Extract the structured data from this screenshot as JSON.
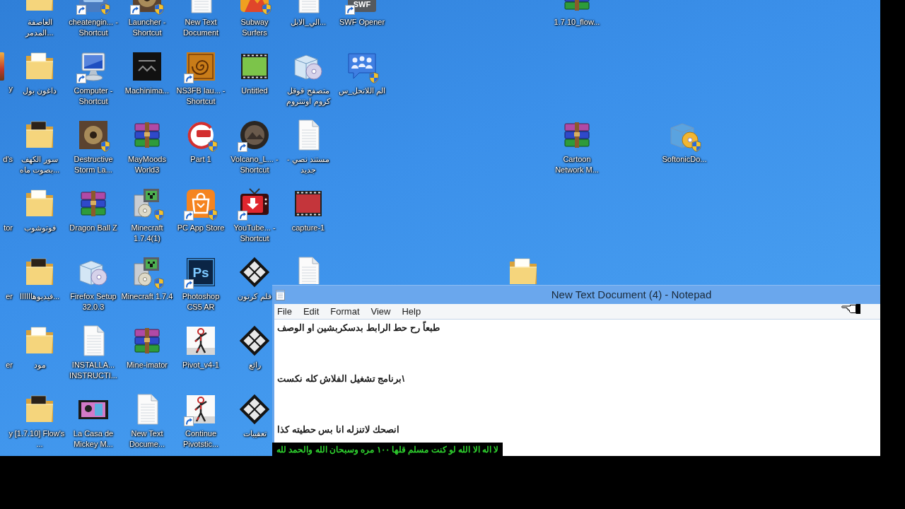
{
  "desktop": {
    "columns": [
      {
        "icons": [
          {
            "kind": "empty"
          },
          {
            "kind": "sliver",
            "label": "y"
          },
          {
            "kind": "cut",
            "label": "d's"
          },
          {
            "kind": "cut",
            "label": "tor"
          },
          {
            "kind": "cut",
            "label": "er"
          },
          {
            "kind": "cut",
            "label": "er"
          },
          {
            "kind": "cut",
            "label": "y"
          }
        ]
      },
      {
        "icons": [
          {
            "kind": "folder",
            "label": "العاصفة المدمر...",
            "shortcut": false,
            "shield": false
          },
          {
            "kind": "folder",
            "label": "داغون بول",
            "shortcut": false,
            "shield": false
          },
          {
            "kind": "folder-dark",
            "label": "سور الكهف بصوت ماه...",
            "shortcut": false,
            "shield": false
          },
          {
            "kind": "folder",
            "label": "فوتوشوب",
            "shortcut": false,
            "shield": false
          },
          {
            "kind": "folder-dark",
            "label": "فيديوهاااااا...",
            "shortcut": false,
            "shield": false
          },
          {
            "kind": "folder",
            "label": "مود",
            "shortcut": false,
            "shield": false
          },
          {
            "kind": "folder-dark",
            "label": "[1.7.10] Flow's ...",
            "shortcut": false,
            "shield": false
          }
        ]
      },
      {
        "icons": [
          {
            "kind": "blue-app",
            "label": "cheatengin... - Shortcut",
            "shortcut": true,
            "shield": true
          },
          {
            "kind": "monitor",
            "label": "Computer - Shortcut",
            "shortcut": true,
            "shield": false
          },
          {
            "kind": "bronze-app",
            "label": "Destructive Storm La...",
            "shortcut": false,
            "shield": true
          },
          {
            "kind": "archive",
            "label": "Dragon Ball Z",
            "shortcut": false,
            "shield": false
          },
          {
            "kind": "box-disc",
            "label": "Firefox Setup 32.0.3",
            "shortcut": false,
            "shield": false
          },
          {
            "kind": "document",
            "label": "INSTALLA... INSTRUCTI...",
            "shortcut": false,
            "shield": false
          },
          {
            "kind": "video-thumb",
            "label": "La Casa de Mickey M...",
            "shortcut": false,
            "shield": false
          }
        ]
      },
      {
        "icons": [
          {
            "kind": "bronze-app",
            "label": "Launcher - Shortcut",
            "shortcut": true,
            "shield": true
          },
          {
            "kind": "dark-app",
            "label": "Machinima...",
            "shortcut": false,
            "shield": false
          },
          {
            "kind": "archive",
            "label": "MayMoods World3",
            "shortcut": false,
            "shield": false
          },
          {
            "kind": "minecraft-installer",
            "label": "Minecraft 1.7.4(1)",
            "shortcut": false,
            "shield": true
          },
          {
            "kind": "minecraft-installer",
            "label": "Minecraft 1.7.4",
            "shortcut": false,
            "shield": true
          },
          {
            "kind": "archive",
            "label": "Mine-imator",
            "shortcut": false,
            "shield": false
          },
          {
            "kind": "document",
            "label": "New Text Docume...",
            "shortcut": false,
            "shield": false
          }
        ]
      },
      {
        "icons": [
          {
            "kind": "document",
            "label": "New Text Document",
            "shortcut": false,
            "shield": false
          },
          {
            "kind": "spiral-app",
            "label": "NS3FB lau... - Shortcut",
            "shortcut": true,
            "shield": false
          },
          {
            "kind": "ring-logo",
            "label": "Part 1",
            "shortcut": false,
            "shield": true
          },
          {
            "kind": "bag",
            "label": "PC App Store",
            "shortcut": true,
            "shield": true
          },
          {
            "kind": "ps-app",
            "logo_text": "Ps",
            "label": "Photoshop CS5 AR",
            "shortcut": true,
            "shield": false
          },
          {
            "kind": "stick-figure",
            "label": "Pivot_v4-1",
            "shortcut": false,
            "shield": false
          },
          {
            "kind": "stick-figure",
            "label": "Continue Pivotstic...",
            "shortcut": true,
            "shield": false
          }
        ]
      },
      {
        "icons": [
          {
            "kind": "orange-app",
            "label": "Subway Surfers",
            "shortcut": false,
            "shield": true
          },
          {
            "kind": "film-green",
            "label": "Untitled",
            "shortcut": false,
            "shield": false
          },
          {
            "kind": "round-photo",
            "label": "Volcano_L... - Shortcut",
            "shortcut": true,
            "shield": false
          },
          {
            "kind": "tv-download",
            "label": "YouTube... - Shortcut",
            "shortcut": true,
            "shield": false
          },
          {
            "kind": "film-diamond",
            "label": "فلم كرتون",
            "shortcut": false,
            "shield": false
          },
          {
            "kind": "film-diamond",
            "label": "رائع",
            "shortcut": false,
            "shield": false
          },
          {
            "kind": "film-diamond",
            "label": "تعقيبات",
            "shortcut": false,
            "shield": false
          }
        ]
      },
      {
        "icons": [
          {
            "kind": "image-document",
            "label": "الي_الابل...",
            "shortcut": false,
            "shield": false
          },
          {
            "kind": "box-disc",
            "label": "متصفح قوقل كروم اوتنتروم",
            "shortcut": false,
            "shield": false
          },
          {
            "kind": "document",
            "label": "مستند نصي - جديد",
            "shortcut": false,
            "shield": false
          },
          {
            "kind": "film-red",
            "label": "capture-1",
            "shortcut": false,
            "shield": false
          },
          {
            "kind": "document",
            "shortcut": false,
            "shield": false
          }
        ]
      },
      {
        "icons": [
          {
            "kind": "swf-app",
            "logo_text": "SWF",
            "label": "SWF Opener",
            "shortcut": true,
            "shield": false
          },
          {
            "kind": "chat-people",
            "label": "الم اللاتحل_س",
            "shortcut": false,
            "shield": true
          }
        ]
      },
      {
        "icons": [
          {
            "kind": "empty"
          }
        ]
      },
      {
        "icons": [
          {
            "kind": "empty"
          }
        ]
      },
      {
        "icons": [
          {
            "kind": "empty"
          },
          {
            "kind": "empty"
          },
          {
            "kind": "empty"
          },
          {
            "kind": "empty"
          },
          {
            "kind": "folder",
            "shortcut": false,
            "shield": false
          }
        ]
      },
      {
        "icons": [
          {
            "kind": "archive",
            "label": "1.7.10_flow...",
            "shortcut": false,
            "shield": false
          },
          {
            "kind": "empty"
          },
          {
            "kind": "archive",
            "label": "Cartoon Network M...",
            "shortcut": false,
            "shield": false
          }
        ]
      },
      {
        "icons": [
          {
            "kind": "empty"
          }
        ]
      },
      {
        "icons": [
          {
            "kind": "empty"
          },
          {
            "kind": "empty"
          },
          {
            "kind": "box-disc-gold",
            "label": "SoftonicDo...",
            "shortcut": false,
            "shield": true
          }
        ]
      }
    ]
  },
  "notepad": {
    "title": "New Text Document (4) - Notepad",
    "menu": [
      "File",
      "Edit",
      "Format",
      "View",
      "Help"
    ],
    "lines": [
      "طبعاً رح حط الرابط بدسكربشين او الوصف",
      "برنامج تشغيل الفلاش كله نكست\\",
      "انصحك لاتنزله انا بس حطيته كذا"
    ]
  },
  "caption": {
    "text": "لا اله الا الله لو كنت مسلم قلها ١٠٠ مره وسبحان الله والحمد لله"
  }
}
